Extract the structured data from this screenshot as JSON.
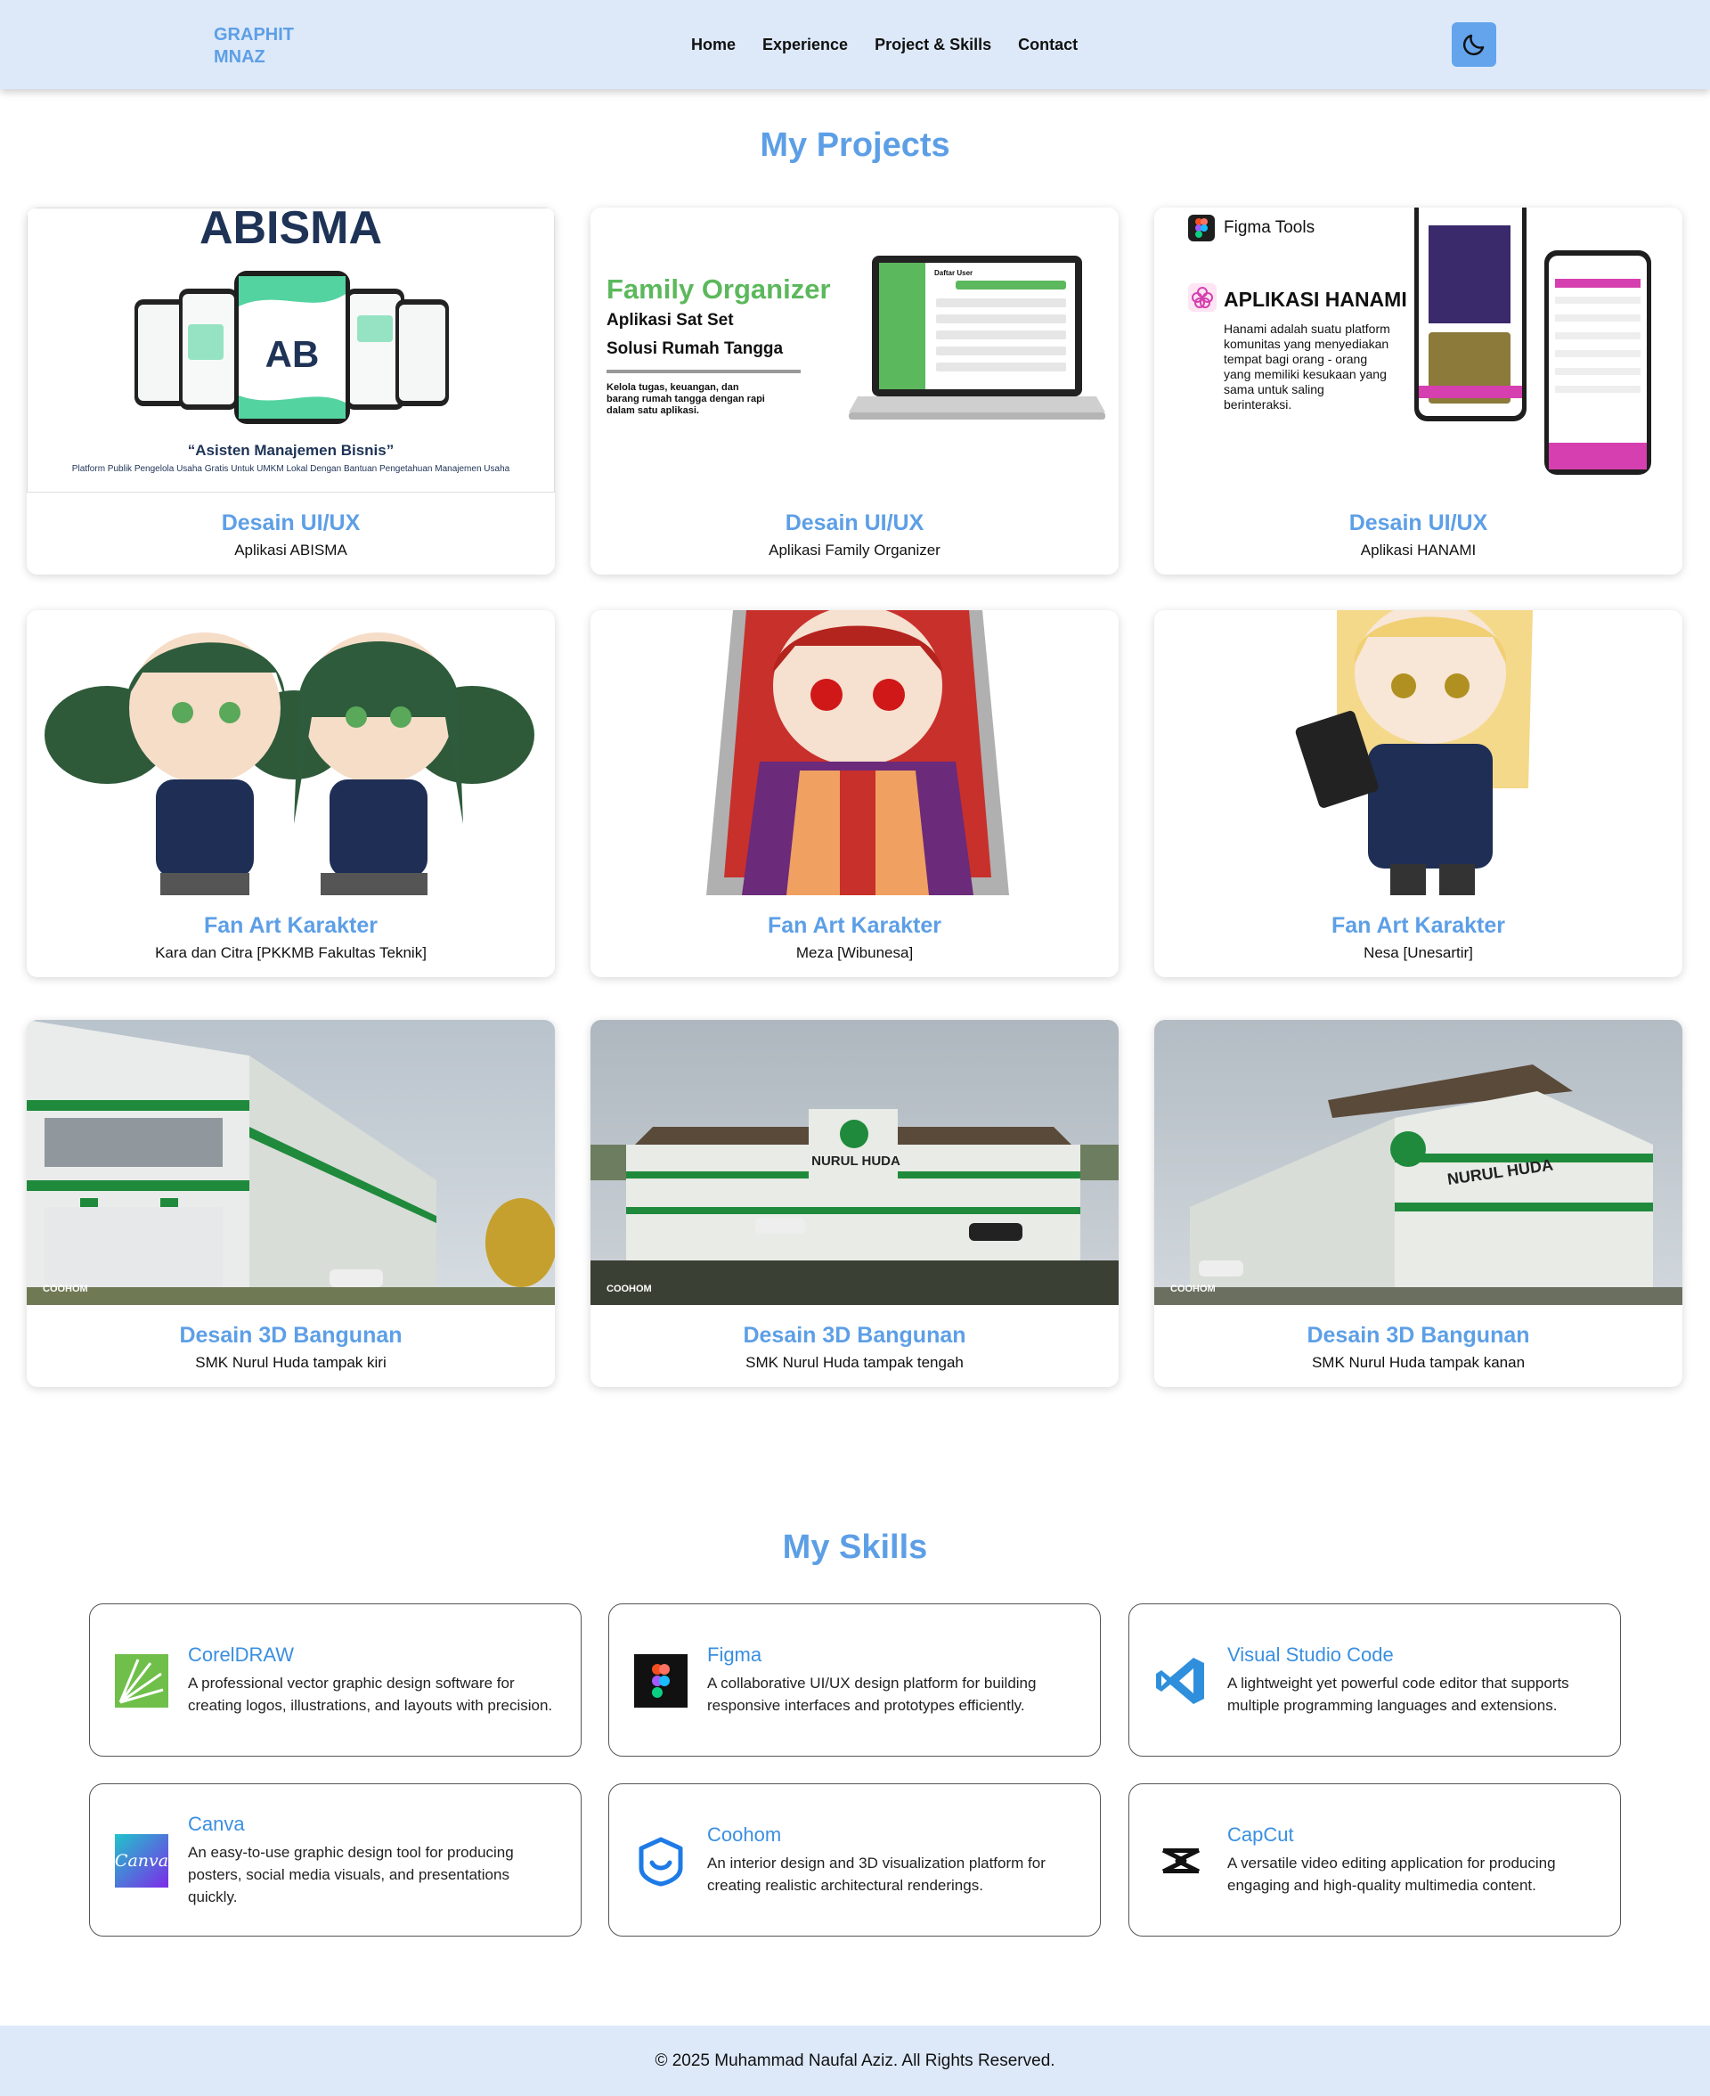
{
  "nav": {
    "brand_line1": "GRAPHIT",
    "brand_line2": "MNAZ",
    "links": [
      "Home",
      "Experience",
      "Project & Skills",
      "Contact"
    ],
    "theme_toggle_icon": "moon-icon"
  },
  "projects": {
    "title": "My Projects",
    "cards": [
      {
        "title": "Desain UI/UX",
        "subtitle": "Aplikasi ABISMA",
        "thumb": {
          "heading": "ABISMA",
          "tagline": "“Asisten Manajemen Bisnis”",
          "caption": "Platform Publik Pengelola Usaha Gratis Untuk UMKM Lokal Dengan Bantuan Pengetahuan Manajemen Usaha"
        }
      },
      {
        "title": "Desain UI/UX",
        "subtitle": "Aplikasi Family Organizer",
        "thumb": {
          "heading": "Family Organizer",
          "line1": "Aplikasi Sat Set",
          "line2": "Solusi Rumah Tangga",
          "desc": "Kelola tugas, keuangan, dan barang rumah tangga dengan rapi dalam satu aplikasi.",
          "screen_title": "Daftar User"
        }
      },
      {
        "title": "Desain UI/UX",
        "subtitle": "Aplikasi HANAMI",
        "thumb": {
          "tool": "Figma Tools",
          "heading": "APLIKASI HANAMI",
          "desc": "Hanami adalah suatu platform komunitas yang menyediakan tempat bagi orang - orang yang memiliki kesukaan yang sama untuk saling berinteraksi."
        }
      },
      {
        "title": "Fan Art Karakter",
        "subtitle": "Kara dan Citra [PKKMB Fakultas Teknik]"
      },
      {
        "title": "Fan Art Karakter",
        "subtitle": "Meza [Wibunesa]"
      },
      {
        "title": "Fan Art Karakter",
        "subtitle": "Nesa [Unesartir]"
      },
      {
        "title": "Desain 3D Bangunan",
        "subtitle": "SMK Nurul Huda tampak kiri",
        "thumb": {
          "watermark": "COOHOM"
        }
      },
      {
        "title": "Desain 3D Bangunan",
        "subtitle": "SMK Nurul Huda tampak tengah",
        "thumb": {
          "watermark": "COOHOM",
          "sign": "NURUL HUDA"
        }
      },
      {
        "title": "Desain 3D Bangunan",
        "subtitle": "SMK Nurul Huda tampak kanan",
        "thumb": {
          "watermark": "COOHOM",
          "sign": "NURUL HUDA"
        }
      }
    ]
  },
  "skills": {
    "title": "My Skills",
    "items": [
      {
        "name": "CorelDRAW",
        "desc": "A professional vector graphic design software for creating logos, illustrations, and layouts with precision.",
        "icon": "coreldraw-icon"
      },
      {
        "name": "Figma",
        "desc": "A collaborative UI/UX design platform for building responsive interfaces and prototypes efficiently.",
        "icon": "figma-icon"
      },
      {
        "name": "Visual Studio Code",
        "desc": "A lightweight yet powerful code editor that supports multiple programming languages and extensions.",
        "icon": "vscode-icon"
      },
      {
        "name": "Canva",
        "desc": "An easy-to-use graphic design tool for producing posters, social media visuals, and presentations quickly.",
        "icon": "canva-icon",
        "icon_text": "Canva"
      },
      {
        "name": "Coohom",
        "desc": "An interior design and 3D visualization platform for creating realistic architectural renderings.",
        "icon": "coohom-icon"
      },
      {
        "name": "CapCut",
        "desc": "A versatile video editing application for producing engaging and high-quality multimedia content.",
        "icon": "capcut-icon"
      }
    ]
  },
  "footer": {
    "text": "© 2025 Muhammad Naufal Aziz. All Rights Reserved."
  },
  "colors": {
    "accent": "#5d9fe6",
    "nav_bg": "#dde9f9",
    "toggle_bg": "#63a4ec"
  }
}
